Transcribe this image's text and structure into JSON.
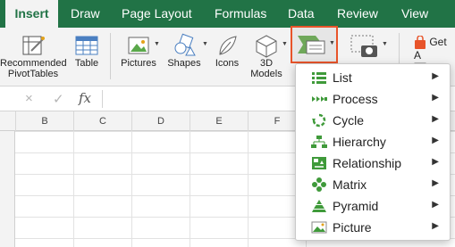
{
  "tabs": [
    "Insert",
    "Draw",
    "Page Layout",
    "Formulas",
    "Data",
    "Review",
    "View"
  ],
  "ribbon": {
    "recommended_line1": "Recommended",
    "recommended_line2": "PivotTables",
    "table": "Table",
    "pictures": "Pictures",
    "shapes": "Shapes",
    "icons": "Icons",
    "models_line1": "3D",
    "models_line2": "Models",
    "get_addins": "Get A"
  },
  "formula_bar": {
    "cancel_icon": "×",
    "confirm_icon": "✓",
    "fx": "fx"
  },
  "columns": [
    "B",
    "C",
    "D",
    "E",
    "F"
  ],
  "smartart_menu": {
    "items": [
      {
        "label": "List",
        "icon": "list-icon",
        "arrow": "▶"
      },
      {
        "label": "Process",
        "icon": "process-icon",
        "arrow": "▶"
      },
      {
        "label": "Cycle",
        "icon": "cycle-icon",
        "arrow": "▶"
      },
      {
        "label": "Hierarchy",
        "icon": "hierarchy-icon",
        "arrow": "▶"
      },
      {
        "label": "Relationship",
        "icon": "relationship-icon",
        "arrow": "▶"
      },
      {
        "label": "Matrix",
        "icon": "matrix-icon",
        "arrow": "▶"
      },
      {
        "label": "Pyramid",
        "icon": "pyramid-icon",
        "arrow": "▶"
      },
      {
        "label": "Picture",
        "icon": "picture-icon",
        "arrow": "▶"
      }
    ]
  },
  "colors": {
    "ribbon_green": "#217346",
    "highlight_orange": "#e8542a",
    "icon_green": "#3f9a3a"
  }
}
